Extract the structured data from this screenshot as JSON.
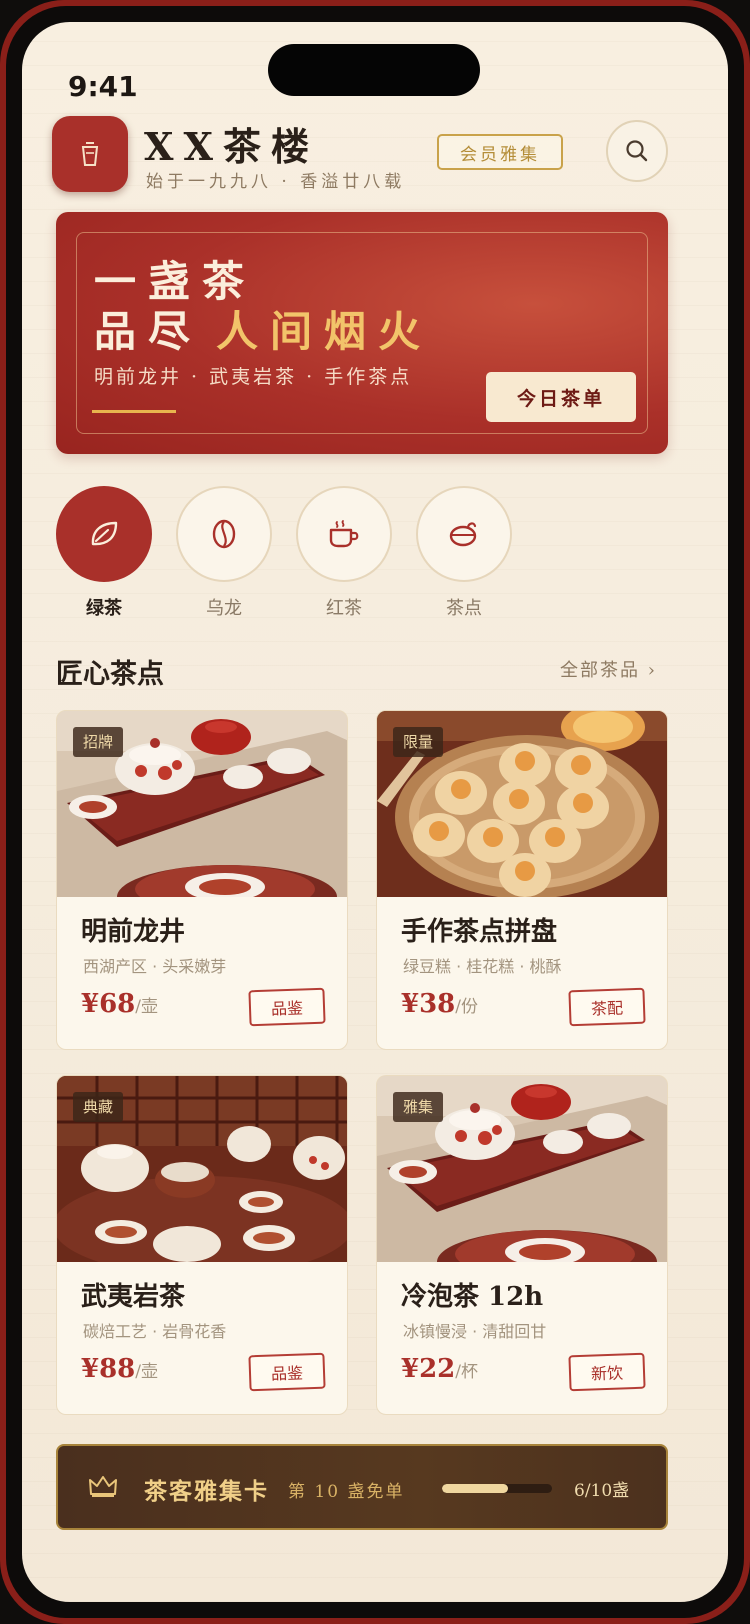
{
  "status_bar": {
    "time": "9:41"
  },
  "header": {
    "title": "XX茶楼",
    "subtitle": "始于一九九八 · 香溢廿八载",
    "member_button": "会员雅集"
  },
  "banner": {
    "line1": "一盏茶",
    "line2_a": "品尽",
    "line2_b": "人间烟火",
    "subtitle": "明前龙井 · 武夷岩茶 · 手作茶点",
    "button": "今日茶单"
  },
  "categories": [
    {
      "label": "绿茶",
      "icon": "leaf-icon",
      "active": true
    },
    {
      "label": "乌龙",
      "icon": "tea-bean-icon",
      "active": false
    },
    {
      "label": "红茶",
      "icon": "tea-cup-icon",
      "active": false
    },
    {
      "label": "茶点",
      "icon": "teapot-icon",
      "active": false
    }
  ],
  "section": {
    "title": "匠心茶点",
    "more": "全部茶品 ›"
  },
  "products": [
    {
      "tag": "招牌",
      "name": "明前龙井",
      "desc": "西湖产区 · 头采嫩芽",
      "price": "¥68",
      "unit": "/壶",
      "button": "品鉴",
      "image": "tea-set-photo"
    },
    {
      "tag": "限量",
      "name": "手作茶点拼盘",
      "desc": "绿豆糕 · 桂花糕 · 桃酥",
      "price": "¥38",
      "unit": "/份",
      "button": "茶配",
      "image": "pastry-photo"
    },
    {
      "tag": "典藏",
      "name": "武夷岩茶",
      "desc": "碳焙工艺 · 岩骨花香",
      "price": "¥88",
      "unit": "/壶",
      "button": "品鉴",
      "image": "tea-room-photo"
    },
    {
      "tag": "雅集",
      "name": "冷泡茶 12h",
      "desc": "冰镇慢浸 · 清甜回甘",
      "price": "¥22",
      "unit": "/杯",
      "button": "新饮",
      "image": "tea-set-photo"
    }
  ],
  "loyalty": {
    "title": "茶客雅集卡",
    "subtitle": "第 10 盏免单",
    "count": "6/10盏",
    "progress": 0.6
  },
  "colors": {
    "primary_red": "#a9302a",
    "gold": "#c9a24a",
    "cream": "#f8efe0",
    "dark_brown": "#4a2f1e"
  }
}
